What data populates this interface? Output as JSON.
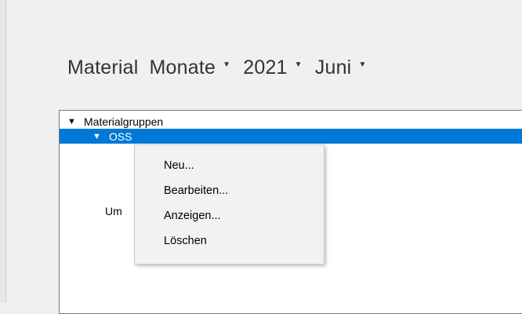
{
  "breadcrumb": {
    "root": "Material",
    "items": [
      {
        "label": "Monate"
      },
      {
        "label": "2021"
      },
      {
        "label": "Juni"
      }
    ]
  },
  "tree": {
    "root_label": "Materialgruppen",
    "selected_label": "OSS",
    "partial_label": "Um"
  },
  "context_menu": {
    "items": [
      "Neu...",
      "Bearbeiten...",
      "Anzeigen...",
      "Löschen"
    ]
  },
  "colors": {
    "selection": "#0078d7",
    "background": "#f0f0f0",
    "menu_background": "#f2f2f2"
  }
}
